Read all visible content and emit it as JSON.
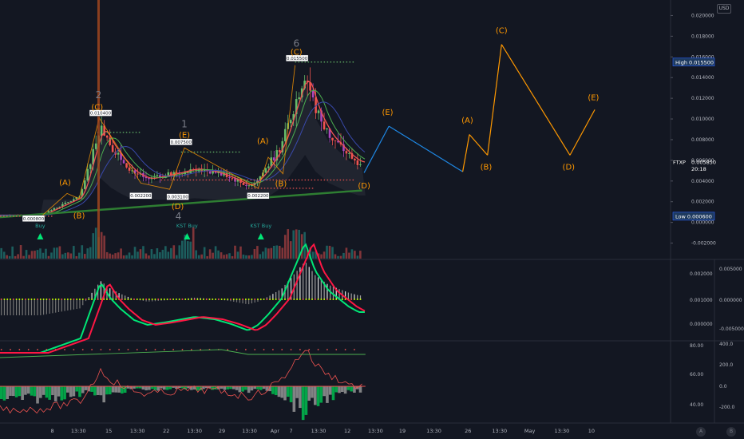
{
  "currency_badge": "USD",
  "chart_data": [
    {
      "type": "line",
      "panel": "price",
      "ylim": [
        -0.0035,
        0.0215
      ],
      "yticks": [
        "0.020000",
        "0.018000",
        "0.016000",
        "0.014000",
        "0.012000",
        "0.010000",
        "0.008000",
        "0.006000",
        "0.004000",
        "0.002000",
        "0.000000",
        "-0.002000"
      ],
      "ytick_values": [
        0.02,
        0.018,
        0.016,
        0.014,
        0.012,
        0.01,
        0.008,
        0.006,
        0.004,
        0.002,
        0.0,
        -0.002
      ],
      "xticks": [
        "8",
        "13:30",
        "15",
        "13:30",
        "22",
        "13:30",
        "29",
        "13:30",
        "Apr",
        "7",
        "13:30",
        "12",
        "13:30",
        "19",
        "13:30",
        "26",
        "13:30",
        "May",
        "13:30",
        "10"
      ],
      "xtick_pos": [
        0.078,
        0.117,
        0.162,
        0.205,
        0.248,
        0.29,
        0.331,
        0.372,
        0.41,
        0.434,
        0.475,
        0.518,
        0.56,
        0.6,
        0.647,
        0.698,
        0.745,
        0.79,
        0.838,
        0.882
      ],
      "price_tags": [
        {
          "label": "High",
          "value": "0.015500",
          "y": 0.0155,
          "bg": "#2962ff"
        },
        {
          "label": "FTXP",
          "value": "0.005850",
          "y": 0.00585,
          "time": "20:18"
        },
        {
          "label": "Low",
          "value": "0.000600",
          "y": 0.0006,
          "bg": "#2962ff"
        }
      ],
      "boxes": [
        {
          "text": "0.000800",
          "x": 0.05,
          "y": 0.0003
        },
        {
          "text": "0.010400",
          "x": 0.15,
          "y": 0.0105
        },
        {
          "text": "0.002200",
          "x": 0.21,
          "y": 0.0025
        },
        {
          "text": "0.007500",
          "x": 0.27,
          "y": 0.0077
        },
        {
          "text": "0.003100",
          "x": 0.265,
          "y": 0.0024
        },
        {
          "text": "0.002200",
          "x": 0.385,
          "y": 0.0025
        },
        {
          "text": "0.015500",
          "x": 0.443,
          "y": 0.0158
        }
      ],
      "wave_labels": [
        {
          "text": "(A)",
          "x": 0.097,
          "y": 0.0036
        },
        {
          "text": "(B)",
          "x": 0.118,
          "y": 0.0004
        },
        {
          "text": "(C)",
          "x": 0.145,
          "y": 0.0109
        },
        {
          "text": "(D)",
          "x": 0.265,
          "y": 0.0013
        },
        {
          "text": "(E)",
          "x": 0.275,
          "y": 0.0082
        },
        {
          "text": "(A)",
          "x": 0.392,
          "y": 0.0076
        },
        {
          "text": "(B)",
          "x": 0.419,
          "y": 0.0035
        },
        {
          "text": "(C)",
          "x": 0.442,
          "y": 0.0162
        },
        {
          "text": "(D)",
          "x": 0.543,
          "y": 0.0033
        },
        {
          "text": "(E)",
          "x": 0.578,
          "y": 0.0104
        },
        {
          "text": "(A)",
          "x": 0.697,
          "y": 0.0096
        },
        {
          "text": "(B)",
          "x": 0.725,
          "y": 0.0051
        },
        {
          "text": "(C)",
          "x": 0.748,
          "y": 0.0183
        },
        {
          "text": "(D)",
          "x": 0.848,
          "y": 0.0051
        },
        {
          "text": "(E)",
          "x": 0.885,
          "y": 0.0118
        }
      ],
      "wave_numbers": [
        {
          "text": "2",
          "x": 0.147,
          "y": 0.012
        },
        {
          "text": "1",
          "x": 0.275,
          "y": 0.0092
        },
        {
          "text": "4",
          "x": 0.266,
          "y": 0.0003
        },
        {
          "text": "6",
          "x": 0.442,
          "y": 0.017
        }
      ],
      "kst_signals": [
        {
          "text": "Buy",
          "x": 0.06
        },
        {
          "text": "KST Buy",
          "x": 0.279
        },
        {
          "text": "KST Buy",
          "x": 0.389
        }
      ],
      "projection": {
        "x": [
          0.543,
          0.58,
          0.69,
          0.7,
          0.727,
          0.748,
          0.85,
          0.887
        ],
        "y": [
          0.0048,
          0.0093,
          0.0049,
          0.0085,
          0.0065,
          0.0172,
          0.0065,
          0.0109
        ],
        "colors": [
          "#1e88e5",
          "#1e88e5",
          "#ff9800",
          "#ff9800",
          "#ff9800",
          "#ff9800",
          "#ff9800"
        ]
      }
    },
    {
      "type": "line",
      "panel": "oscillator",
      "yticks_left": [
        "0.002000",
        "0.001000",
        "0.000000"
      ],
      "yticks_right": [
        "0.005000",
        "0.000000",
        "-0.005000"
      ]
    },
    {
      "type": "bar",
      "panel": "indicator",
      "yticks_left": [
        "80.00",
        "60.00",
        "40.00"
      ],
      "yticks_right": [
        "400.0",
        "200.0",
        "0.0",
        "-200.0"
      ]
    }
  ]
}
